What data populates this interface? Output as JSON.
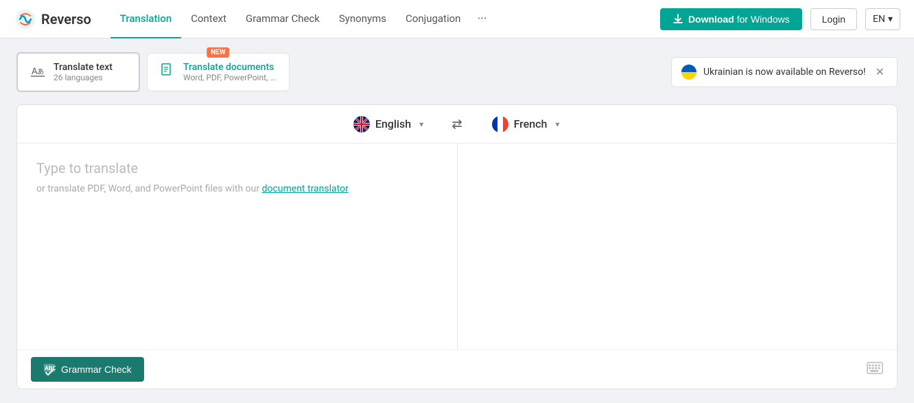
{
  "logo": {
    "text": "Reverso"
  },
  "nav": {
    "items": [
      {
        "label": "Translation",
        "active": true
      },
      {
        "label": "Context",
        "active": false
      },
      {
        "label": "Grammar Check",
        "active": false
      },
      {
        "label": "Synonyms",
        "active": false
      },
      {
        "label": "Conjugation",
        "active": false
      }
    ],
    "more_label": "···"
  },
  "header": {
    "download_label": "Download",
    "download_suffix": " for Windows",
    "login_label": "Login",
    "lang_label": "EN"
  },
  "tabs": {
    "translate_text": {
      "title": "Translate text",
      "subtitle": "26 languages"
    },
    "translate_docs": {
      "title": "Translate documents",
      "subtitle": "Word, PDF, PowerPoint, ...",
      "badge": "NEW"
    }
  },
  "notification": {
    "text": "Ukrainian is now available on Reverso!"
  },
  "language_bar": {
    "source_lang": "English",
    "target_lang": "French"
  },
  "translation_area": {
    "placeholder_main": "Type to translate",
    "placeholder_sub_prefix": "or translate PDF, Word, and PowerPoint files with our ",
    "placeholder_sub_link": "document translator"
  },
  "bottom_bar": {
    "grammar_btn": "Grammar Check",
    "keyboard_tooltip": "keyboard"
  }
}
